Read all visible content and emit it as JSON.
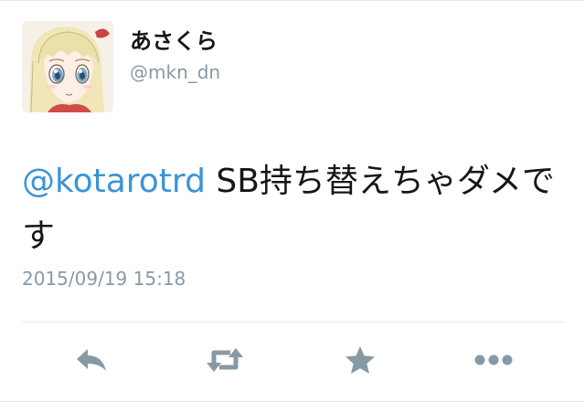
{
  "tweet": {
    "display_name": "あさくら",
    "screen_name": "@mkn_dn",
    "text": {
      "mention": "@kotarotrd",
      "body": " SB持ち替えちゃダメです"
    },
    "timestamp": "2015/09/19 15:18"
  },
  "actions": [
    {
      "id": "reply",
      "icon": "reply-icon"
    },
    {
      "id": "retweet",
      "icon": "retweet-icon"
    },
    {
      "id": "favorite",
      "icon": "star-icon"
    },
    {
      "id": "more",
      "icon": "more-icon"
    }
  ],
  "colors": {
    "mention": "#3a94d6",
    "text": "#14171a",
    "muted": "#8899a6",
    "icon": "#8899a6",
    "divider": "#e1e8ed"
  }
}
